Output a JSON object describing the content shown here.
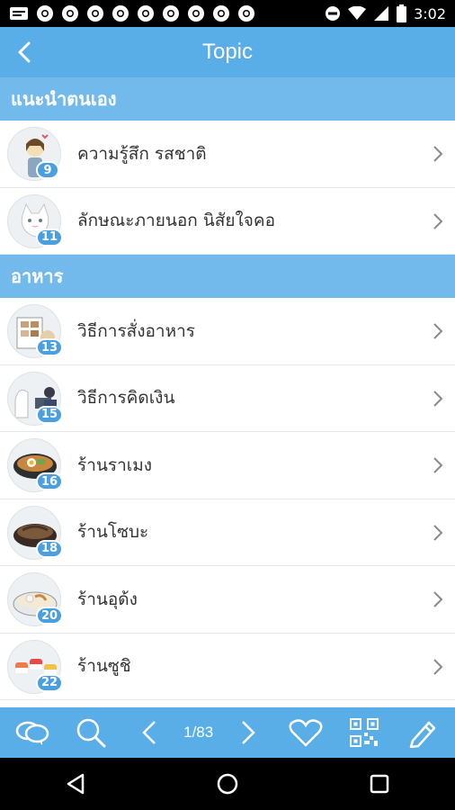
{
  "status_bar": {
    "time": "3:02",
    "icons": [
      "message-icon",
      "chrome-icon",
      "chrome-icon",
      "chrome-icon",
      "chrome-icon",
      "chrome-icon",
      "chrome-icon",
      "chrome-icon",
      "chrome-icon",
      "chrome-icon",
      "dnd-icon",
      "wifi-icon",
      "signal-icon",
      "battery-icon"
    ]
  },
  "app_bar": {
    "title": "Topic",
    "back_icon": "chevron-left-icon"
  },
  "sections": [
    {
      "title": "แนะนำตนเอง",
      "items": [
        {
          "label": "ความรู้สึก รสชาติ",
          "badge": "9"
        },
        {
          "label": "ลักษณะภายนอก นิสัยใจคอ",
          "badge": "11"
        }
      ]
    },
    {
      "title": "อาหาร",
      "items": [
        {
          "label": "วิธีการสั่งอาหาร",
          "badge": "13"
        },
        {
          "label": "วิธีการคิดเงิน",
          "badge": "15"
        },
        {
          "label": "ร้านราเมง",
          "badge": "16"
        },
        {
          "label": "ร้านโซบะ",
          "badge": "18"
        },
        {
          "label": "ร้านอุด้ง",
          "badge": "20"
        },
        {
          "label": "ร้านซูชิ",
          "badge": "22"
        }
      ]
    }
  ],
  "toolbar": {
    "page_indicator": "1/83",
    "icons": [
      "chat-bubbles-icon",
      "search-icon",
      "prev-arrow-icon",
      "next-arrow-icon",
      "heart-icon",
      "qr-code-icon",
      "pencil-icon"
    ]
  },
  "nav_bar": {
    "icons": [
      "back-triangle-icon",
      "home-circle-icon",
      "recents-square-icon"
    ]
  },
  "colors": {
    "primary": "#5aaee8",
    "section": "#72b9ec",
    "badge": "#4a9fe0"
  }
}
